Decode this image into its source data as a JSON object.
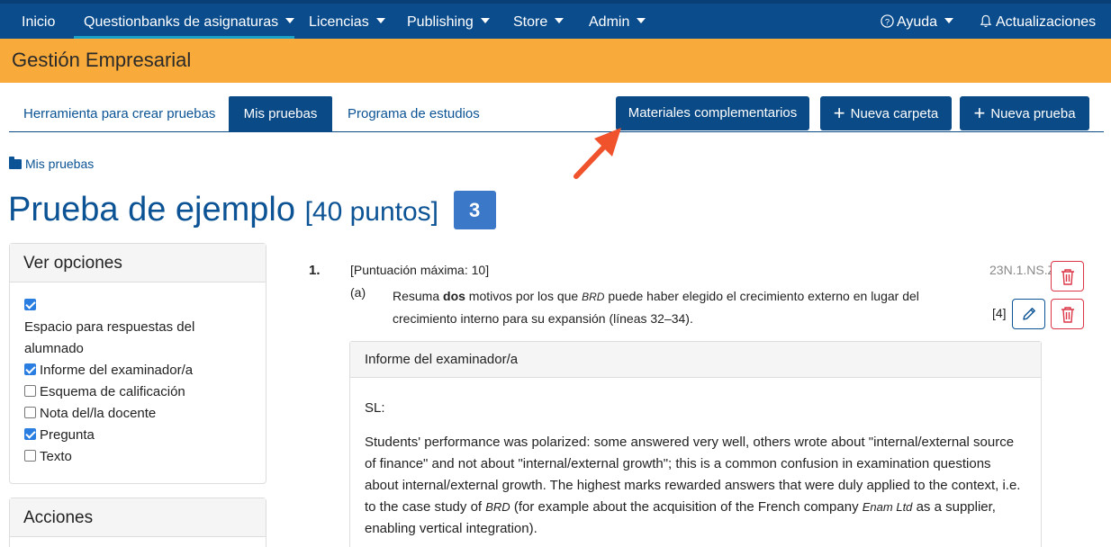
{
  "navbar": {
    "items": [
      {
        "label": "Inicio"
      },
      {
        "label": "Questionbanks de asignaturas"
      },
      {
        "label": "Licencias"
      },
      {
        "label": "Publishing"
      },
      {
        "label": "Store"
      },
      {
        "label": "Admin"
      }
    ],
    "help_label": "Ayuda",
    "updates_label": "Actualizaciones",
    "accent_color": "#0b4c8c"
  },
  "subject": {
    "title": "Gestión Empresarial",
    "color": "#f8ab3a"
  },
  "tabs": [
    {
      "label": "Herramienta para crear pruebas",
      "active": false
    },
    {
      "label": "Mis pruebas",
      "active": true
    },
    {
      "label": "Programa de estudios",
      "active": false
    }
  ],
  "buttons": {
    "materials": "Materiales complementarios",
    "new_folder": "Nueva carpeta",
    "new_test": "Nueva prueba"
  },
  "breadcrumb": {
    "label": "Mis pruebas"
  },
  "page": {
    "title": "Prueba de ejemplo",
    "points": "[40 puntos]",
    "badge": "3"
  },
  "view_options": {
    "title": "Ver opciones",
    "options": [
      {
        "label": "Espacio para respuestas del alumnado",
        "checked": true
      },
      {
        "label": "Informe del examinador/a",
        "checked": true
      },
      {
        "label": "Esquema de calificación",
        "checked": false
      },
      {
        "label": "Nota del/la docente",
        "checked": false
      },
      {
        "label": "Pregunta",
        "checked": true
      },
      {
        "label": "Texto",
        "checked": false
      }
    ]
  },
  "actions": {
    "title": "Acciones"
  },
  "question": {
    "number": "1.",
    "max_score": "[Puntuación máxima: 10]",
    "code": "23N.1.NS.ZM.1",
    "part": "(a)",
    "text_before": "Resuma ",
    "text_bold": "dos",
    "text_mid": " motivos por los que ",
    "text_italic": "BRD",
    "text_after": " puede haber elegido el crecimiento externo en lugar del crecimiento interno para su expansión (líneas 32–34).",
    "marks": "[4]"
  },
  "report": {
    "title": "Informe del examinador/a",
    "level": "SL:",
    "p1": "Students' performance was polarized: some answered very well, others wrote about \"internal/external source of finance\" and not about \"internal/external growth\"; this is a common confusion in examination questions about internal/external growth. The highest marks rewarded answers that were duly applied to the context, i.e. to the case study of ",
    "p1_italic": "BRD",
    "p2": " (for example about the acquisition of the French company ",
    "p2_italic": "Enam Ltd",
    "p3": " as a supplier, enabling vertical integration)."
  }
}
